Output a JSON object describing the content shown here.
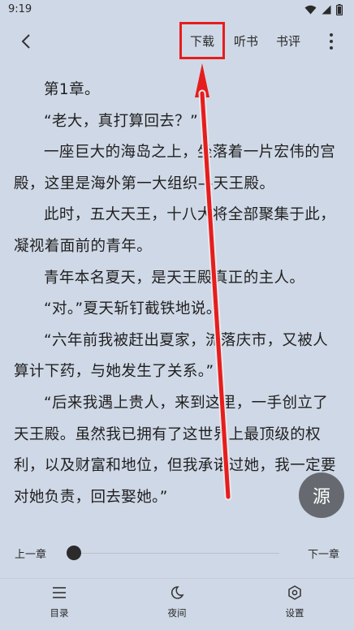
{
  "status": {
    "time": "9:19"
  },
  "toolbar": {
    "download": "下载",
    "listen": "听书",
    "review": "书评"
  },
  "paragraphs": [
    "第1章。",
    "“老大，真打算回去？”",
    "一座巨大的海岛之上，坐落着一片宏伟的宫殿，这里是海外第一大组织—天王殿。",
    "此时，五大天王，十八大将全部聚集于此，凝视着面前的青年。",
    "青年本名夏天，是天王殿真正的主人。",
    "“对。”夏天斩钉截铁地说。",
    "“六年前我被赶出夏家，流落庆市，又被人算计下药，与她发生了关系。”",
    "“后来我遇上贵人，来到这里，一手创立了天王殿。虽然我已拥有了这世界上最顶级的权利，以及财富和地位，但我承诺过她，我一定要对她负责，回去娶她。”"
  ],
  "fab": {
    "label": "源"
  },
  "chapter_nav": {
    "prev": "上一章",
    "next": "下一章",
    "progress": 0
  },
  "bottom_nav": [
    {
      "label": "目录",
      "icon": "menu-icon"
    },
    {
      "label": "夜间",
      "icon": "moon-icon"
    },
    {
      "label": "设置",
      "icon": "settings-icon"
    }
  ],
  "colors": {
    "background": "#cfd8e6",
    "highlight": "#e61d1d",
    "fab": "#666a70"
  }
}
